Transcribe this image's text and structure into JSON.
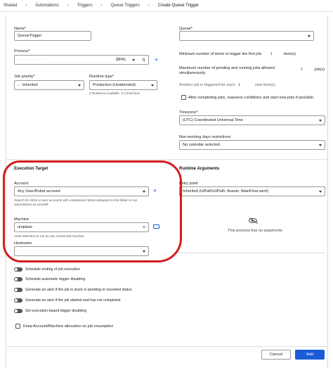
{
  "breadcrumb": [
    "Shared",
    "Automations",
    "Triggers",
    "Queue Triggers",
    "Create Queue Trigger"
  ],
  "name": {
    "label": "Name*",
    "value": "QueueTrigger"
  },
  "process": {
    "label": "Process*",
    "value": "(BPA)",
    "filter_icon": "filter-icon"
  },
  "job_priority": {
    "label": "Job priority*",
    "value": "Inherited"
  },
  "runtime_type": {
    "label": "Runtime type*",
    "value": "Production (Unattended)",
    "hint": "2 Runtimes Available, 3 Connected"
  },
  "queue": {
    "label": "Queue*",
    "value": ""
  },
  "min_items": {
    "label": "Minimum number of items to trigger the first job.",
    "value": "1",
    "suffix": "item(s)"
  },
  "max_jobs": {
    "label": "Maximum number of pending and running jobs allowed simultaneously.",
    "value": "1",
    "suffix": "job(s)"
  },
  "another_job": {
    "label": "Another job is triggered for each",
    "value": "1",
    "suffix": "new item(s)"
  },
  "reassess": {
    "label": "After completing jobs, reassess conditions and start new jobs if possible."
  },
  "timezone": {
    "label": "Timezone*",
    "value": "(UTC) Coordinated Universal Time"
  },
  "non_working": {
    "label": "Non-working days restrictions",
    "value": "No calendar selected."
  },
  "execution_target": {
    "title": "Execution Target",
    "account_label": "Account",
    "account_value": "Any User/Robot account",
    "account_hint": "Search for robot or user accounts with unattended robots assigned to this folder or run automations as yourself.",
    "machine_label": "Machine",
    "machine_value": "umplase",
    "machine_hint": "Clear selection to run on any connected machine",
    "hostname_label": "Hostname",
    "hostname_value": ""
  },
  "runtime_args": {
    "title": "Runtime Arguments",
    "entry_label": "Entry point",
    "entry_value": "Inherited (UiPath\\UiPath. Assets. MainFlow.xaml)",
    "empty_text": "This process has no arguments"
  },
  "toggles": [
    "Schedule ending of job execution",
    "Schedule automatic trigger disabling",
    "Generate an alert if the job is stuck in pending or resumed status",
    "Generate an alert if the job started and has not completed",
    "Set execution-based trigger disabling"
  ],
  "keep_account": {
    "label": "Keep Account/Machine allocation on job resumption"
  },
  "buttons": {
    "cancel": "Cancel",
    "add": "Add"
  },
  "colors": {
    "accent": "#1a5bd8",
    "annotation": "#d51c1c"
  }
}
